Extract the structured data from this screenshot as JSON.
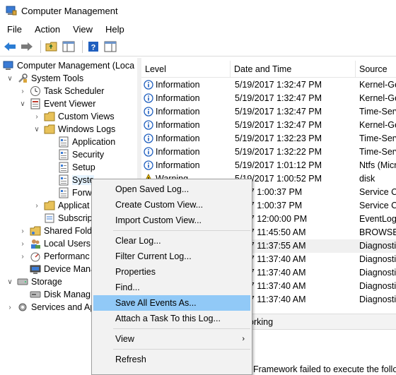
{
  "window": {
    "title": "Computer Management"
  },
  "menubar": {
    "items": [
      "File",
      "Action",
      "View",
      "Help"
    ]
  },
  "toolbar": {
    "buttons": [
      "back-arrow-icon",
      "forward-arrow-icon",
      "folder-up-icon",
      "console-tree-icon",
      "help-icon",
      "properties-icon"
    ]
  },
  "tree": {
    "root": "Computer Management (Local",
    "system_tools": "System Tools",
    "task_scheduler": "Task Scheduler",
    "event_viewer": "Event Viewer",
    "custom_views": "Custom Views",
    "windows_logs": "Windows Logs",
    "application": "Application",
    "security": "Security",
    "setup": "Setup",
    "system": "Syste",
    "forwarded": "Forw",
    "applications_services": "Applicat",
    "subscriptions": "Subscrip",
    "shared_folders": "Shared Fold",
    "local_users": "Local Users",
    "performance": "Performanc",
    "device_manager": "Device Mana",
    "storage": "Storage",
    "disk_management": "Disk Manag",
    "services_apps": "Services and Ap"
  },
  "grid": {
    "columns": [
      "Level",
      "Date and Time",
      "Source"
    ],
    "rows": [
      {
        "level": "Information",
        "date": "5/19/2017 1:32:47 PM",
        "source": "Kernel-Ge"
      },
      {
        "level": "Information",
        "date": "5/19/2017 1:32:47 PM",
        "source": "Kernel-Ge"
      },
      {
        "level": "Information",
        "date": "5/19/2017 1:32:47 PM",
        "source": "Time-Serv"
      },
      {
        "level": "Information",
        "date": "5/19/2017 1:32:47 PM",
        "source": "Kernel-Ge"
      },
      {
        "level": "Information",
        "date": "5/19/2017 1:32:23 PM",
        "source": "Time-Serv"
      },
      {
        "level": "Information",
        "date": "5/19/2017 1:32:22 PM",
        "source": "Time-Serv"
      },
      {
        "level": "Information",
        "date": "5/19/2017 1:01:12 PM",
        "source": "Ntfs (Micr"
      },
      {
        "level": "Warning",
        "date": "5/19/2017 1:00:52 PM",
        "source": "disk"
      },
      {
        "level": "",
        "date": "2017 1:00:37 PM",
        "source": "Service Co"
      },
      {
        "level": "",
        "date": "2017 1:00:37 PM",
        "source": "Service Co"
      },
      {
        "level": "",
        "date": "2017 12:00:00 PM",
        "source": "EventLog"
      },
      {
        "level": "",
        "date": "2017 11:45:50 AM",
        "source": "BROWSER"
      },
      {
        "level": "",
        "date": "2017 11:37:55 AM",
        "source": "Diagnosti"
      },
      {
        "level": "",
        "date": "2017 11:37:40 AM",
        "source": "Diagnosti"
      },
      {
        "level": "",
        "date": "2017 11:37:40 AM",
        "source": "Diagnosti"
      },
      {
        "level": "",
        "date": "2017 11:37:40 AM",
        "source": "Diagnosti"
      },
      {
        "level": "",
        "date": "2017 11:37:40 AM",
        "source": "Diagnosti"
      }
    ]
  },
  "details": {
    "tab": "orking",
    "text": "Framework failed to execute the follow"
  },
  "context_menu": {
    "items": [
      {
        "label": "Open Saved Log..."
      },
      {
        "label": "Create Custom View..."
      },
      {
        "label": "Import Custom View..."
      },
      {
        "label": "Clear Log..."
      },
      {
        "label": "Filter Current Log..."
      },
      {
        "label": "Properties"
      },
      {
        "label": "Find..."
      },
      {
        "label": "Save All Events As...",
        "highlighted": true
      },
      {
        "label": "Attach a Task To this Log..."
      },
      {
        "label": "View",
        "submenu_arrow": "›"
      },
      {
        "label": "Refresh"
      }
    ]
  },
  "colors": {
    "selection": "#e5f3ff",
    "menu_highlight": "#91c9f7",
    "info_icon": "#1f5fbf",
    "warning_icon": "#f2c200"
  }
}
